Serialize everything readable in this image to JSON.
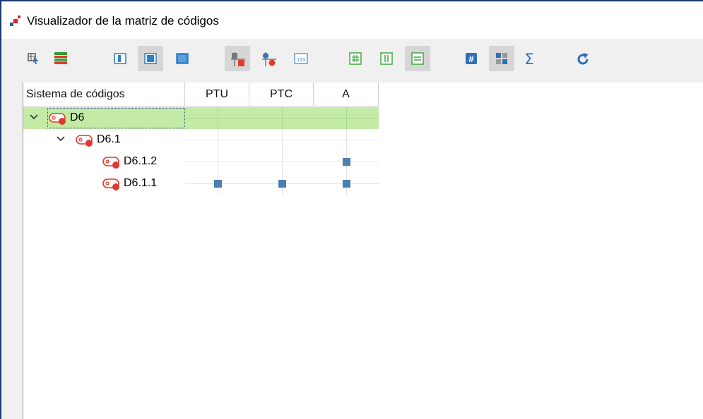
{
  "window": {
    "title": "Visualizador de la matriz de códigos"
  },
  "toolbar": {
    "buttons": [
      {
        "icon": "select-cursor-icon",
        "active": false
      },
      {
        "icon": "color-rows-icon",
        "active": false
      },
      {
        "icon": "layout-left-icon",
        "active": false
      },
      {
        "icon": "layout-center-icon",
        "active": true
      },
      {
        "icon": "layout-full-icon",
        "active": false
      },
      {
        "icon": "squares-symbol-icon",
        "active": true
      },
      {
        "icon": "circles-symbol-icon",
        "active": false
      },
      {
        "icon": "numbers-123-icon",
        "active": false
      },
      {
        "icon": "grid-hash-icon",
        "active": false
      },
      {
        "icon": "columns-icon",
        "active": false
      },
      {
        "icon": "rows-icon",
        "active": true
      },
      {
        "icon": "hash-count-icon",
        "active": false
      },
      {
        "icon": "matrix-icon",
        "active": true
      },
      {
        "icon": "sigma-icon",
        "active": false
      },
      {
        "icon": "refresh-icon",
        "active": false
      }
    ]
  },
  "grid": {
    "header_first": "Sistema de códigos",
    "columns": [
      "PTU",
      "PTC",
      "A"
    ],
    "rows": [
      {
        "label": "D6",
        "level": 0,
        "expanded": true,
        "selected": true,
        "marks": [
          false,
          false,
          false
        ]
      },
      {
        "label": "D6.1",
        "level": 1,
        "expanded": true,
        "selected": false,
        "marks": [
          false,
          false,
          false
        ]
      },
      {
        "label": "D6.1.2",
        "level": 2,
        "expanded": false,
        "selected": false,
        "marks": [
          false,
          false,
          true
        ]
      },
      {
        "label": "D6.1.1",
        "level": 2,
        "expanded": false,
        "selected": false,
        "marks": [
          true,
          true,
          true
        ]
      }
    ]
  },
  "colors": {
    "selected_row": "#c3eba6",
    "mark": "#4a7fb0",
    "code_icon": "#e03a2e"
  }
}
